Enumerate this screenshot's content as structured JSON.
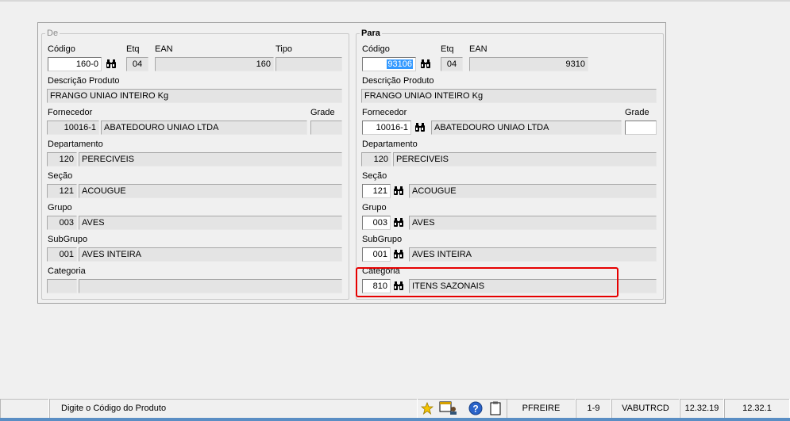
{
  "de": {
    "legend": "De",
    "codigo": {
      "label": "Código",
      "value": "160-0"
    },
    "etq": {
      "label": "Etq",
      "value": "04"
    },
    "ean": {
      "label": "EAN",
      "value": "160"
    },
    "tipo": {
      "label": "Tipo",
      "value": ""
    },
    "descricao": {
      "label": "Descrição Produto",
      "value": "FRANGO UNIAO INTEIRO Kg"
    },
    "fornecedor": {
      "label": "Fornecedor",
      "code": "10016-1",
      "name": "ABATEDOURO UNIAO LTDA"
    },
    "grade": {
      "label": "Grade",
      "value": ""
    },
    "departamento": {
      "label": "Departamento",
      "code": "120",
      "name": "PERECIVEIS"
    },
    "secao": {
      "label": "Seção",
      "code": "121",
      "name": "ACOUGUE"
    },
    "grupo": {
      "label": "Grupo",
      "code": "003",
      "name": "AVES"
    },
    "subgrupo": {
      "label": "SubGrupo",
      "code": "001",
      "name": "AVES INTEIRA"
    },
    "categoria": {
      "label": "Categoria",
      "code": "",
      "name": ""
    }
  },
  "para": {
    "legend": "Para",
    "codigo": {
      "label": "Código",
      "value": "93106"
    },
    "etq": {
      "label": "Etq",
      "value": "04"
    },
    "ean": {
      "label": "EAN",
      "value": "9310"
    },
    "descricao": {
      "label": "Descrição Produto",
      "value": "FRANGO UNIAO INTEIRO Kg"
    },
    "fornecedor": {
      "label": "Fornecedor",
      "code": "10016-1",
      "name": "ABATEDOURO UNIAO LTDA"
    },
    "grade": {
      "label": "Grade",
      "value": ""
    },
    "departamento": {
      "label": "Departamento",
      "code": "120",
      "name": "PERECIVEIS"
    },
    "secao": {
      "label": "Seção",
      "code": "121",
      "name": "ACOUGUE"
    },
    "grupo": {
      "label": "Grupo",
      "code": "003",
      "name": "AVES"
    },
    "subgrupo": {
      "label": "SubGrupo",
      "code": "001",
      "name": "AVES INTEIRA"
    },
    "categoria": {
      "label": "Categoria",
      "code": "810",
      "name": "ITENS SAZONAIS"
    }
  },
  "status": {
    "message": "Digite o Código do Produto",
    "user": "PFREIRE",
    "range": "1-9",
    "host": "VABUTRCD",
    "version1": "12.32.19",
    "version2": "12.32.1"
  },
  "icons": {
    "search": "binoculars-icon",
    "favorite": "star-icon",
    "help": "help-icon",
    "clipboard": "clipboard-icon"
  },
  "colors": {
    "highlight": "#e60000",
    "selection": "#3399ff"
  }
}
